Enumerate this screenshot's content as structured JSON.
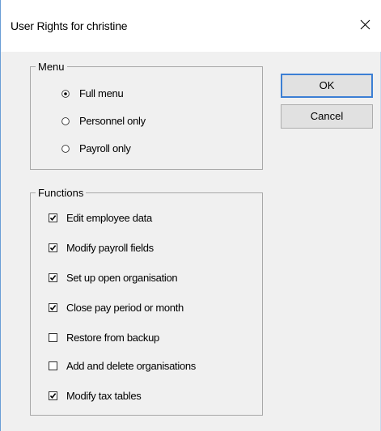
{
  "window": {
    "title": "User Rights for christine"
  },
  "menu_group": {
    "legend": "Menu",
    "options": [
      {
        "label": "Full menu",
        "selected": true
      },
      {
        "label": "Personnel only",
        "selected": false
      },
      {
        "label": "Payroll only",
        "selected": false
      }
    ]
  },
  "functions_group": {
    "legend": "Functions",
    "items": [
      {
        "label": "Edit employee data",
        "checked": true
      },
      {
        "label": "Modify payroll fields",
        "checked": true
      },
      {
        "label": "Set up open organisation",
        "checked": true
      },
      {
        "label": "Close pay period or month",
        "checked": true
      },
      {
        "label": "Restore from backup",
        "checked": false
      },
      {
        "label": "Add and delete organisations",
        "checked": false
      },
      {
        "label": "Modify tax tables",
        "checked": true
      }
    ]
  },
  "buttons": {
    "ok_label": "OK",
    "cancel_label": "Cancel"
  },
  "icons": {
    "close": "close-icon"
  },
  "colors": {
    "dialog_background": "#f0f0f0",
    "titlebar_background": "#ffffff",
    "default_button_border": "#3c7fd4",
    "window_border": "#6a9ed6"
  }
}
